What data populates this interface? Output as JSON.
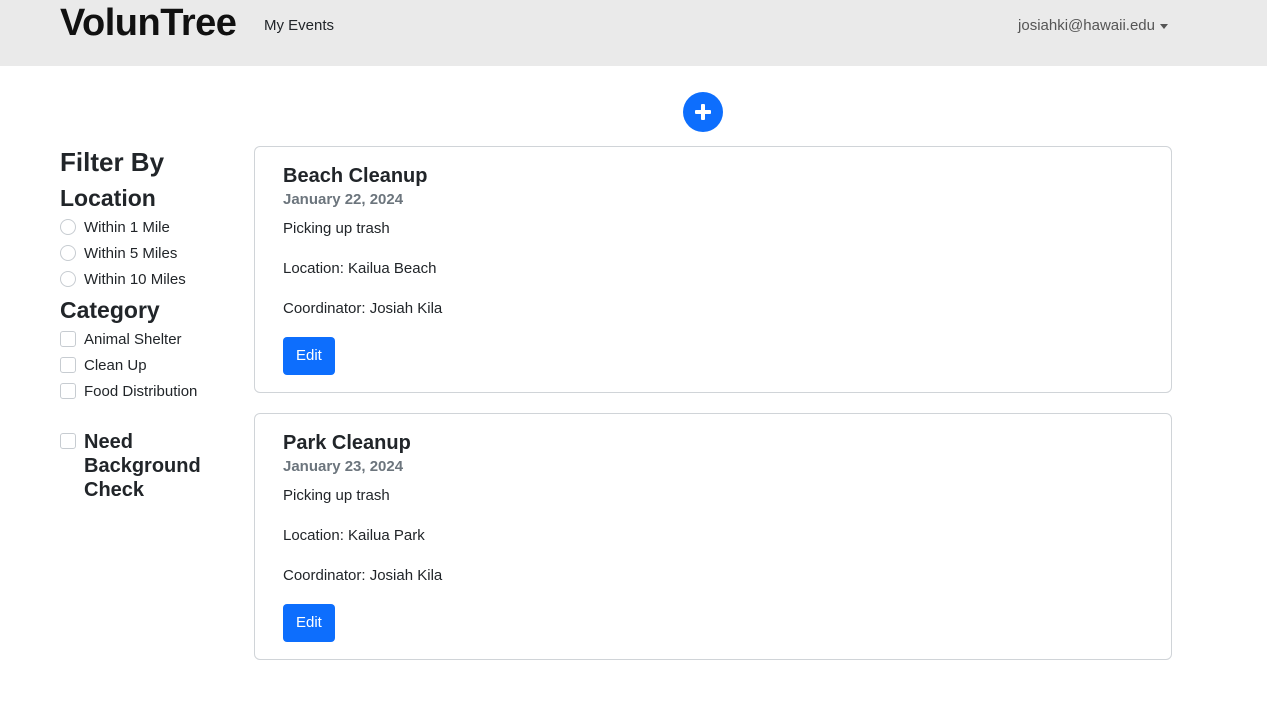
{
  "navbar": {
    "brand": "VolunTree",
    "links": [
      "My Events"
    ],
    "user_email": "josiahki@hawaii.edu"
  },
  "colors": {
    "primary": "#0d6efd",
    "navbar_bg": "#eaeaea"
  },
  "add_button": {
    "icon": "plus-icon"
  },
  "filters": {
    "title": "Filter By",
    "location": {
      "title": "Location",
      "options": [
        "Within 1 Mile",
        "Within 5 Miles",
        "Within 10 Miles"
      ]
    },
    "category": {
      "title": "Category",
      "options": [
        "Animal Shelter",
        "Clean Up",
        "Food Distribution"
      ]
    },
    "background_check": "Need Background Check"
  },
  "events": [
    {
      "title": "Beach Cleanup",
      "date": "January 22, 2024",
      "description": "Picking up trash",
      "location": "Location: Kailua Beach",
      "coordinator": "Coordinator: Josiah Kila",
      "edit_label": "Edit"
    },
    {
      "title": "Park Cleanup",
      "date": "January 23, 2024",
      "description": "Picking up trash",
      "location": "Location: Kailua Park",
      "coordinator": "Coordinator: Josiah Kila",
      "edit_label": "Edit"
    }
  ]
}
